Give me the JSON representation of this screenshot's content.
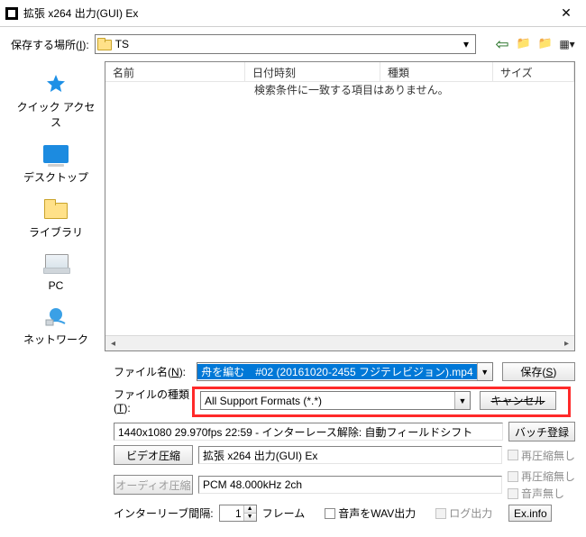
{
  "window": {
    "title": "拡張 x264 出力(GUI) Ex"
  },
  "top": {
    "save_in_label": "保存する場所",
    "save_in_key": "I",
    "path_value": "TS"
  },
  "places": {
    "quick": "クイック アクセス",
    "desktop": "デスクトップ",
    "libraries": "ライブラリ",
    "pc": "PC",
    "network": "ネットワーク"
  },
  "file_list": {
    "col_name": "名前",
    "col_date": "日付時刻",
    "col_kind": "種類",
    "col_size": "サイズ",
    "empty": "検索条件に一致する項目はありません。"
  },
  "form": {
    "filename_label": "ファイル名",
    "filename_key": "N",
    "filename_value": "舟を編む　#02 (20161020-2455 フジテレビジョン).mp4",
    "filetype_label": "ファイルの種類",
    "filetype_key": "T",
    "filetype_value": "All Support Formats (*.*)",
    "save_btn": "保存",
    "save_key": "S",
    "cancel_btn": "キャンセル"
  },
  "lower": {
    "info": "1440x1080 29.970fps 22:59 - インターレース解除: 自動フィールドシフト",
    "batch_btn": "バッチ登録",
    "video_comp_btn": "ビデオ圧縮",
    "video_comp_val": "拡張 x264 出力(GUI) Ex",
    "audio_comp_btn": "オーディオ圧縮",
    "audio_comp_val": "PCM 48.000kHz 2ch",
    "no_recomp": "再圧縮無し",
    "no_audio": "音声無し",
    "interleave_label": "インターリーブ間隔:",
    "interleave_val": "1",
    "interleave_unit": "フレーム",
    "wav_out": "音声をWAV出力",
    "log_out": "ログ出力",
    "exinfo": "Ex.info"
  }
}
